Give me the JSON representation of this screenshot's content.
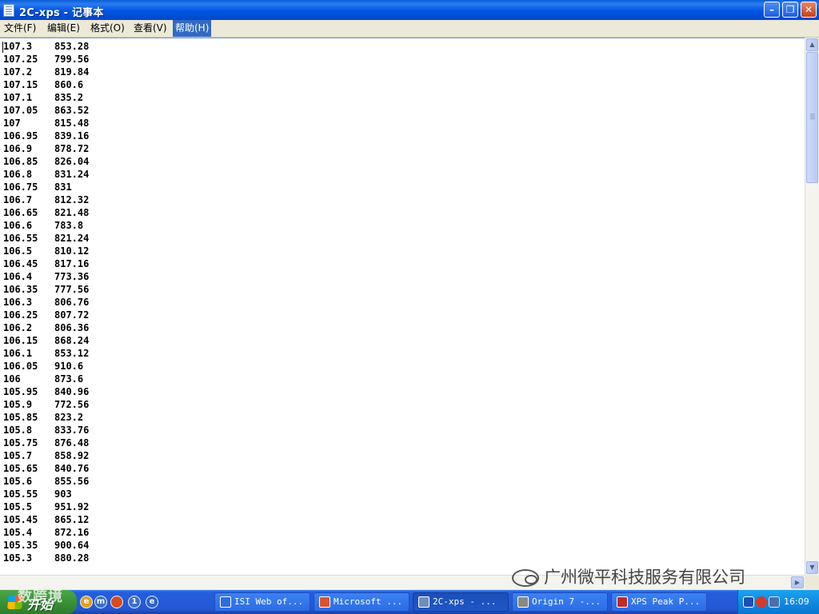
{
  "window": {
    "title": "2C-xps - 记事本",
    "min": "–",
    "max": "❐",
    "close": "✕"
  },
  "menu": [
    {
      "label": "文件(F)"
    },
    {
      "label": "编辑(E)"
    },
    {
      "label": "格式(O)"
    },
    {
      "label": "查看(V)"
    },
    {
      "label": "帮助(H)"
    }
  ],
  "rows": [
    [
      "107.3",
      "853.28"
    ],
    [
      "107.25",
      "799.56"
    ],
    [
      "107.2",
      "819.84"
    ],
    [
      "107.15",
      "860.6"
    ],
    [
      "107.1",
      "835.2"
    ],
    [
      "107.05",
      "863.52"
    ],
    [
      "107",
      "815.48"
    ],
    [
      "106.95",
      "839.16"
    ],
    [
      "106.9",
      "878.72"
    ],
    [
      "106.85",
      "826.04"
    ],
    [
      "106.8",
      "831.24"
    ],
    [
      "106.75",
      "831"
    ],
    [
      "106.7",
      "812.32"
    ],
    [
      "106.65",
      "821.48"
    ],
    [
      "106.6",
      "783.8"
    ],
    [
      "106.55",
      "821.24"
    ],
    [
      "106.5",
      "810.12"
    ],
    [
      "106.45",
      "817.16"
    ],
    [
      "106.4",
      "773.36"
    ],
    [
      "106.35",
      "777.56"
    ],
    [
      "106.3",
      "806.76"
    ],
    [
      "106.25",
      "807.72"
    ],
    [
      "106.2",
      "806.36"
    ],
    [
      "106.15",
      "868.24"
    ],
    [
      "106.1",
      "853.12"
    ],
    [
      "106.05",
      "910.6"
    ],
    [
      "106",
      "873.6"
    ],
    [
      "105.95",
      "840.96"
    ],
    [
      "105.9",
      "772.56"
    ],
    [
      "105.85",
      "823.2"
    ],
    [
      "105.8",
      "833.76"
    ],
    [
      "105.75",
      "876.48"
    ],
    [
      "105.7",
      "858.92"
    ],
    [
      "105.65",
      "840.76"
    ],
    [
      "105.6",
      "855.56"
    ],
    [
      "105.55",
      "903"
    ],
    [
      "105.5",
      "951.92"
    ],
    [
      "105.45",
      "865.12"
    ],
    [
      "105.4",
      "872.16"
    ],
    [
      "105.35",
      "900.64"
    ],
    [
      "105.3",
      "880.28"
    ]
  ],
  "watermark": "广州微平科技服务有限公司",
  "taskbar": {
    "start_label": "开始",
    "start_overlay": "数跨境",
    "tasks": [
      {
        "label": "ISI Web of...",
        "icon_color": "#2b6ce6"
      },
      {
        "label": "Microsoft ...",
        "icon_color": "#d9532c"
      },
      {
        "label": "2C-xps - ...",
        "icon_color": "#6d8fbd"
      },
      {
        "label": "Origin 7 -...",
        "icon_color": "#888888"
      },
      {
        "label": "XPS Peak P...",
        "icon_color": "#c02a2a"
      }
    ],
    "quick_launch": [
      {
        "glyph": "e",
        "color": "#e0a020"
      },
      {
        "glyph": "m",
        "color": "#3a70c8"
      },
      {
        "glyph": "",
        "color": "#d94a20"
      },
      {
        "glyph": "1",
        "color": "#3a70c8"
      },
      {
        "glyph": "e",
        "color": "#2a62c8"
      }
    ],
    "clock": "16:09"
  }
}
